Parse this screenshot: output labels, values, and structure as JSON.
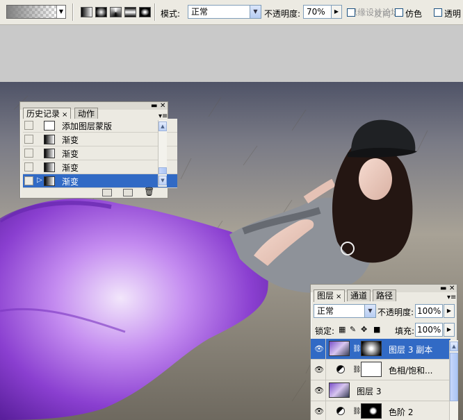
{
  "options_bar": {
    "gradient_dropdown_icon": "down-arrow",
    "gradient_types": [
      "linear",
      "radial",
      "angle",
      "reflected",
      "diamond"
    ],
    "mode_label": "模式:",
    "mode_value": "正常",
    "opacity_label": "不透明度:",
    "opacity_value": "70%",
    "watermark": "思缘设计论坛",
    "reverse_label": "反向",
    "dither_label": "仿色",
    "transparency_label": "透明"
  },
  "history_panel": {
    "tab_history": "历史记录",
    "tab_actions": "动作",
    "close_x": "×",
    "rows": [
      {
        "label": "添加图层蒙版",
        "icon": "doc",
        "selected": false
      },
      {
        "label": "渐变",
        "icon": "gradient",
        "selected": false
      },
      {
        "label": "渐变",
        "icon": "gradient",
        "selected": false
      },
      {
        "label": "渐变",
        "icon": "gradient",
        "selected": false
      },
      {
        "label": "渐变",
        "icon": "gradient",
        "selected": true
      }
    ]
  },
  "layers_panel": {
    "tab_layers": "图层",
    "tab_channels": "通道",
    "tab_paths": "路径",
    "close_x": "×",
    "blend_mode": "正常",
    "opacity_label": "不透明度:",
    "opacity_value": "100%",
    "lock_label": "锁定:",
    "fill_label": "填充:",
    "fill_value": "100%",
    "layers": [
      {
        "name": "图层 3 副本",
        "type": "image-with-mask",
        "selected": true
      },
      {
        "name": "色相/饱和...",
        "type": "adjustment",
        "selected": false
      },
      {
        "name": "图层 3",
        "type": "image",
        "selected": false
      },
      {
        "name": "色阶 2",
        "type": "adjustment",
        "selected": false
      }
    ]
  },
  "colors": {
    "selection": "#316ac5",
    "panel_bg": "#eceae2",
    "dress_purple": "#8a3fd0"
  }
}
